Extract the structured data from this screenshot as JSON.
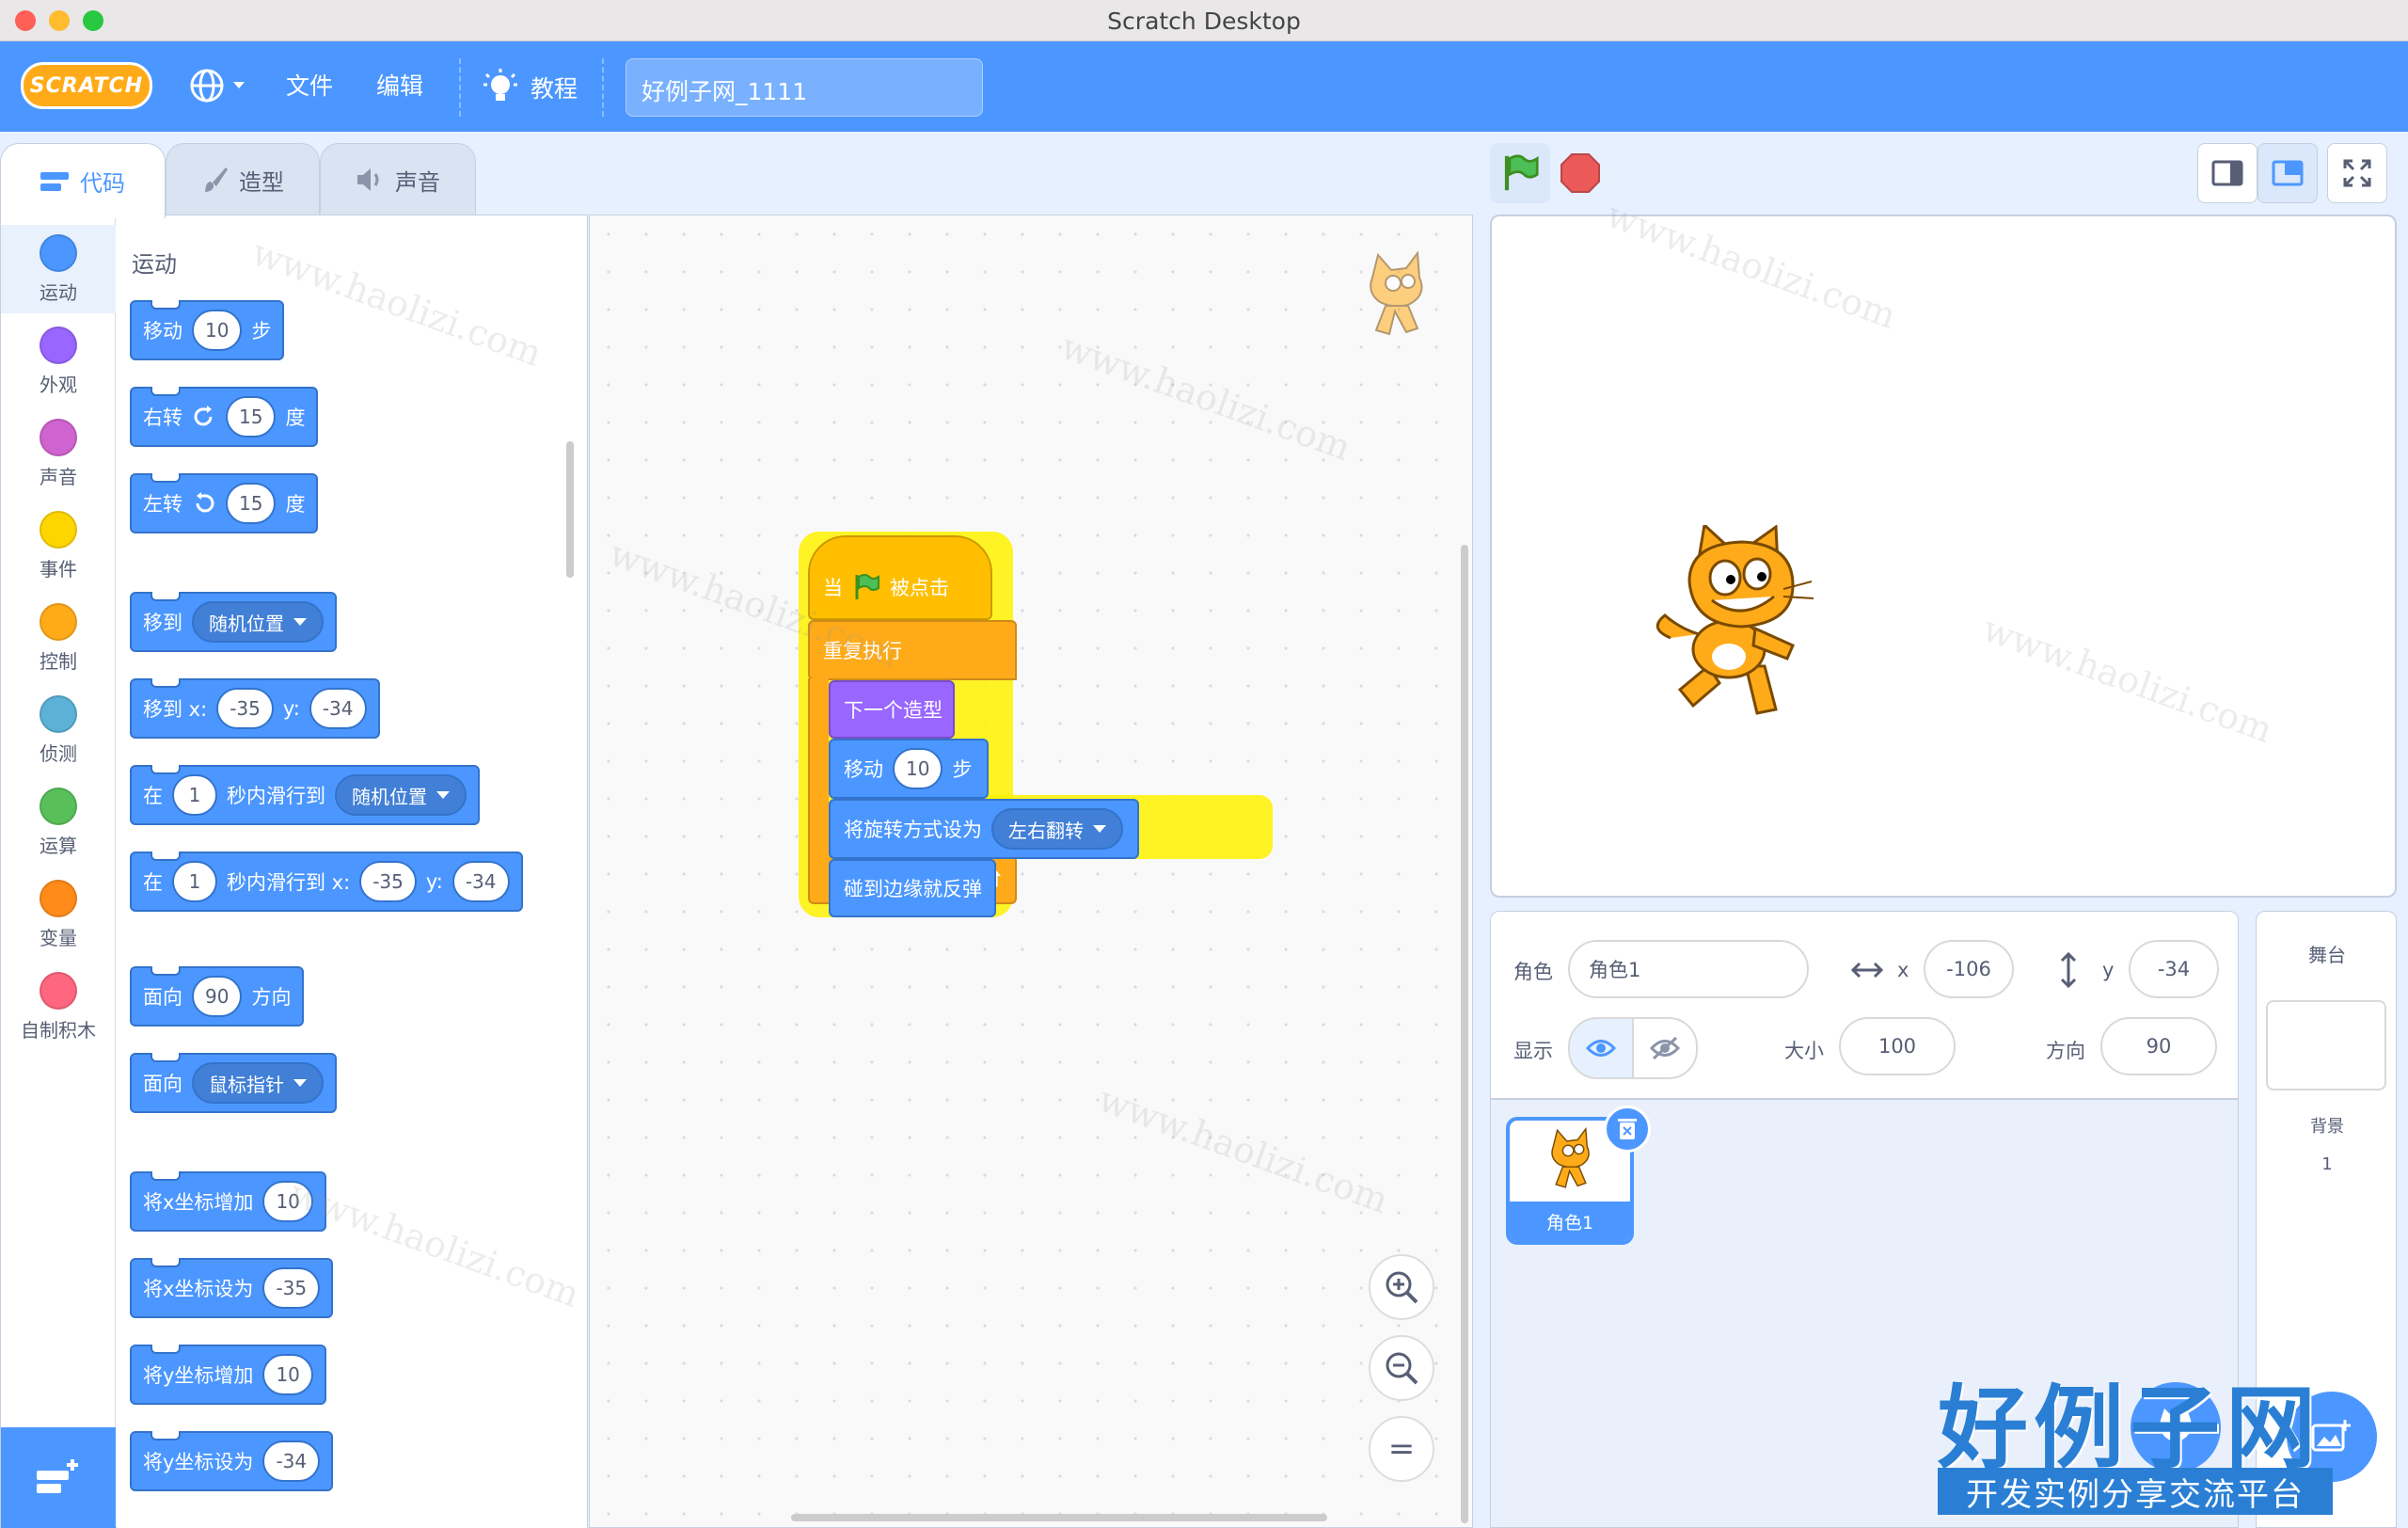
{
  "window": {
    "title": "Scratch Desktop"
  },
  "menubar": {
    "logo": "SCRATCH",
    "language_icon": "globe-icon",
    "file": "文件",
    "edit": "编辑",
    "tutorials": "教程",
    "project_title": "好例子网_1111"
  },
  "tabs": {
    "code": "代码",
    "costumes": "造型",
    "sounds": "声音"
  },
  "categories": [
    {
      "label": "运动",
      "color": "#4c97ff"
    },
    {
      "label": "外观",
      "color": "#9966ff"
    },
    {
      "label": "声音",
      "color": "#cf63cf"
    },
    {
      "label": "事件",
      "color": "#ffd500"
    },
    {
      "label": "控制",
      "color": "#ffab19"
    },
    {
      "label": "侦测",
      "color": "#5cb1d6"
    },
    {
      "label": "运算",
      "color": "#59c059"
    },
    {
      "label": "变量",
      "color": "#ff8c1a"
    },
    {
      "label": "自制积木",
      "color": "#ff6680"
    }
  ],
  "palette": {
    "heading": "运动",
    "move": {
      "a": "移动",
      "v": "10",
      "b": "步"
    },
    "turn_right": {
      "a": "右转",
      "v": "15",
      "b": "度"
    },
    "turn_left": {
      "a": "左转",
      "v": "15",
      "b": "度"
    },
    "goto": {
      "a": "移到",
      "dd": "随机位置"
    },
    "goto_xy": {
      "a": "移到 x:",
      "x": "-35",
      "y_label": "y:",
      "y": "-34"
    },
    "glide": {
      "a": "在",
      "v": "1",
      "b": "秒内滑行到",
      "dd": "随机位置"
    },
    "glide_xy": {
      "a": "在",
      "v": "1",
      "b": "秒内滑行到 x:",
      "x": "-35",
      "y_label": "y:",
      "y": "-34"
    },
    "point_dir": {
      "a": "面向",
      "v": "90",
      "b": "方向"
    },
    "point_towards": {
      "a": "面向",
      "dd": "鼠标指针"
    },
    "change_x": {
      "a": "将x坐标增加",
      "v": "10"
    },
    "set_x": {
      "a": "将x坐标设为",
      "v": "-35"
    },
    "change_y": {
      "a": "将y坐标增加",
      "v": "10"
    },
    "set_y": {
      "a": "将y坐标设为",
      "v": "-34"
    }
  },
  "script": {
    "hat_a": "当",
    "hat_b": "被点击",
    "forever": "重复执行",
    "next_costume": "下一个造型",
    "move_a": "移动",
    "move_v": "10",
    "move_b": "步",
    "rotation_a": "将旋转方式设为",
    "rotation_dd": "左右翻转",
    "bounce": "碰到边缘就反弹"
  },
  "zoom": {
    "reset": "="
  },
  "sprite_info": {
    "sprite_label": "角色",
    "sprite_name": "角色1",
    "x_label": "x",
    "x": "-106",
    "y_label": "y",
    "y": "-34",
    "show_label": "显示",
    "size_label": "大小",
    "size": "100",
    "direction_label": "方向",
    "direction": "90"
  },
  "sprites": [
    {
      "name": "角色1"
    }
  ],
  "stage_pane": {
    "title": "舞台",
    "backdrops_label": "背景",
    "backdrops_count": "1"
  },
  "watermark": {
    "text": "www.haolizi.com",
    "brand": "好例子网",
    "slogan": "开发实例分享交流平台"
  }
}
